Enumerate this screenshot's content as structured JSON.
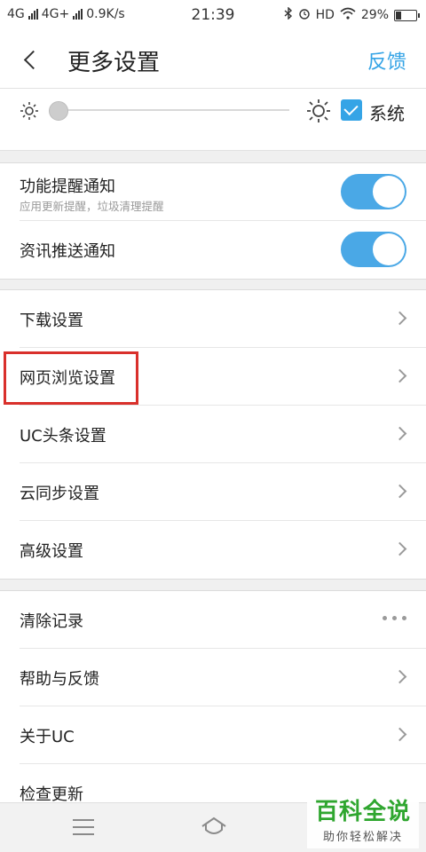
{
  "status_bar": {
    "network_1": "4G",
    "network_2": "4G+",
    "speed": "0.9K/s",
    "time": "21:39",
    "hd": "HD",
    "battery": "29%",
    "battery_level": 0.29
  },
  "header": {
    "title": "更多设置",
    "feedback": "反馈"
  },
  "brightness": {
    "system_label": "系统",
    "system_checked": true,
    "slider_value": 0.0
  },
  "notifications": [
    {
      "label": "功能提醒通知",
      "sub": "应用更新提醒，垃圾清理提醒",
      "on": true
    },
    {
      "label": "资讯推送通知",
      "on": true
    }
  ],
  "settings_group": [
    {
      "label": "下载设置"
    },
    {
      "label": "网页浏览设置",
      "highlighted": true
    },
    {
      "label": "UC头条设置"
    },
    {
      "label": "云同步设置"
    },
    {
      "label": "高级设置"
    }
  ],
  "misc_group": [
    {
      "label": "清除记录",
      "action": "more-dots"
    },
    {
      "label": "帮助与反馈"
    },
    {
      "label": "关于UC"
    },
    {
      "label": "检查更新"
    }
  ],
  "watermark": {
    "title": "百科全说",
    "sub": "助你轻松解决"
  },
  "colors": {
    "accent": "#35a4e6",
    "toggle_on": "#4aa8e6",
    "highlight_box": "#d9302b",
    "watermark_green": "#2fa62f"
  }
}
